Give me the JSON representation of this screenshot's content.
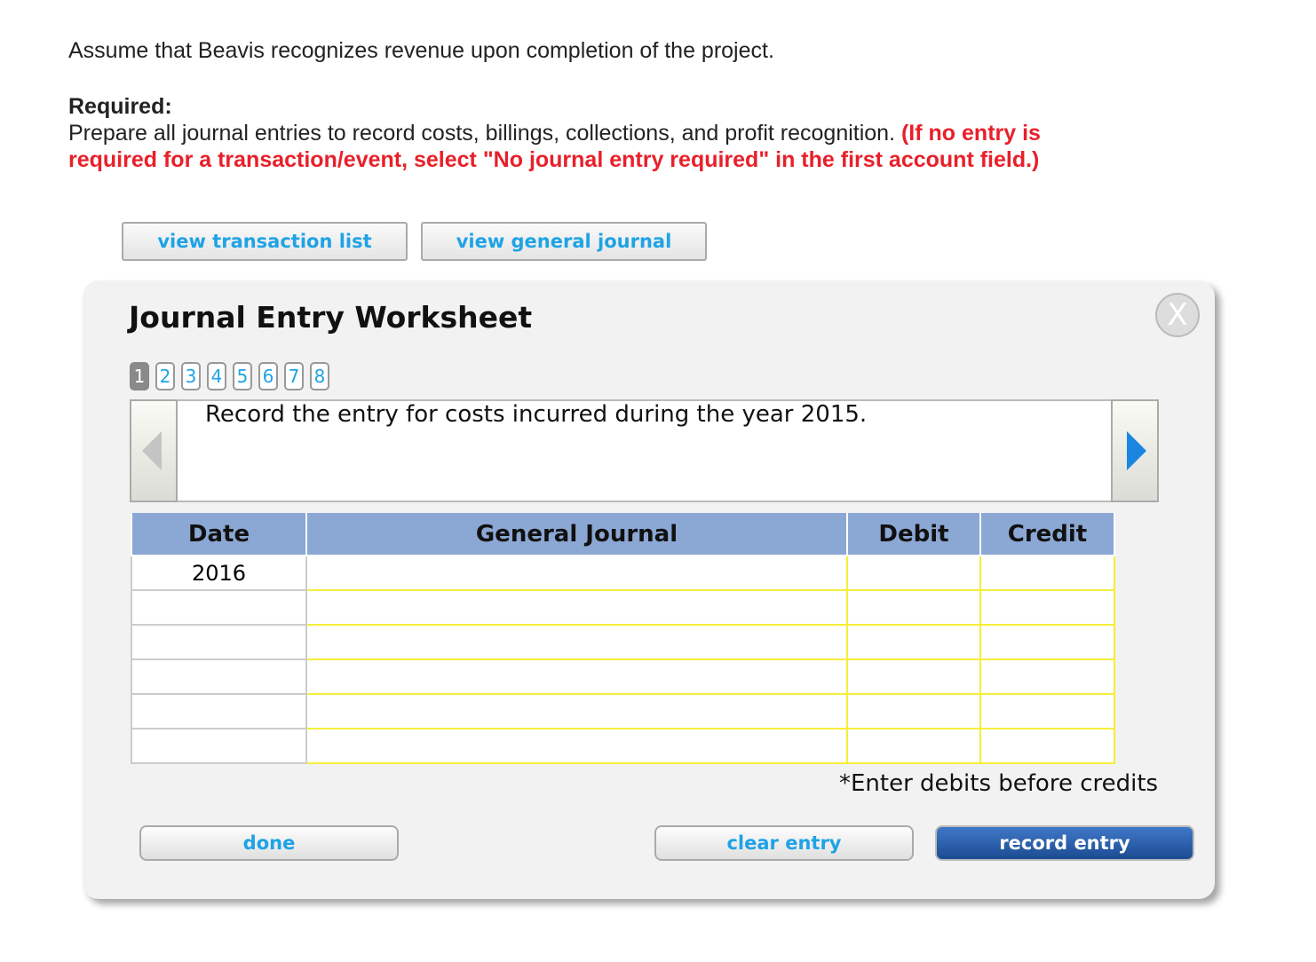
{
  "intro": "Assume that Beavis recognizes revenue upon completion of the project.",
  "required": {
    "heading": "Required:",
    "text": "Prepare all journal entries to record costs, billings, collections, and profit recognition.",
    "note": "(If no entry is required for a transaction/event, select \"No journal entry required\" in the first account field.)"
  },
  "buttons": {
    "view_transaction_list": "view transaction list",
    "view_general_journal": "view general journal",
    "done": "done",
    "clear_entry": "clear entry",
    "record_entry": "record entry"
  },
  "worksheet": {
    "title": "Journal Entry Worksheet",
    "close": "X",
    "pages": [
      "1",
      "2",
      "3",
      "4",
      "5",
      "6",
      "7",
      "8"
    ],
    "active_page": "1",
    "prompt": "Record the entry for costs incurred during the year 2015.",
    "columns": [
      "Date",
      "General Journal",
      "Debit",
      "Credit"
    ],
    "rows": [
      {
        "date": "2016"
      },
      {
        "date": ""
      },
      {
        "date": ""
      },
      {
        "date": ""
      },
      {
        "date": ""
      },
      {
        "date": ""
      }
    ],
    "footnote": "*Enter debits before credits"
  },
  "colors": {
    "link": "#1ea3e6",
    "header": "#8ba7d4",
    "warning": "#e8202a",
    "primary": "#1c4b92"
  }
}
